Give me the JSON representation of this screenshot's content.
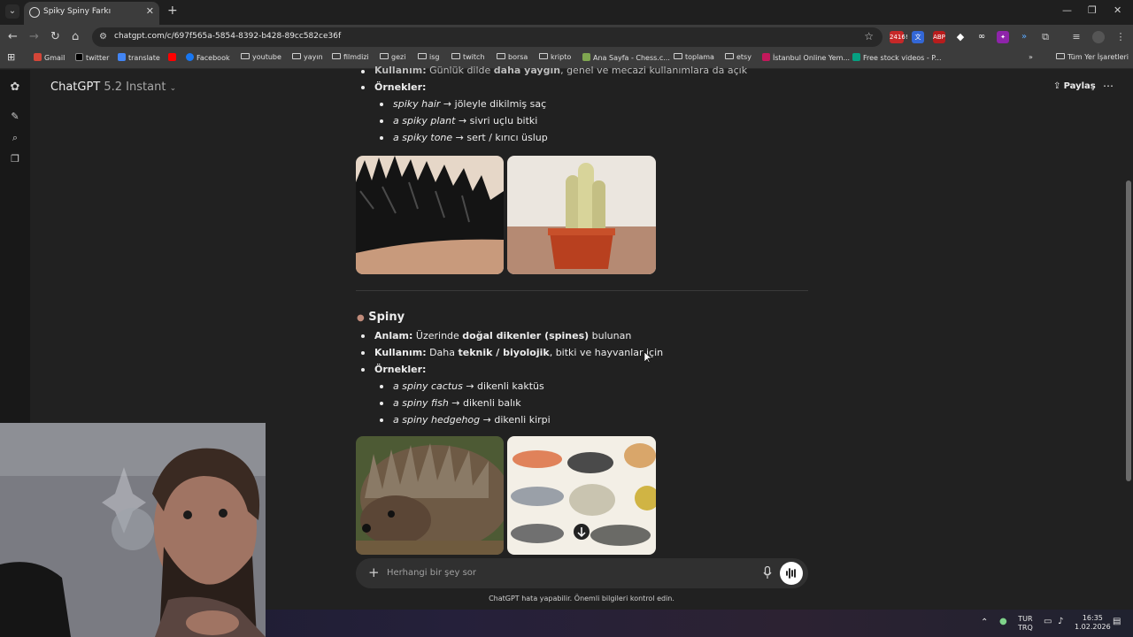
{
  "browser": {
    "tab_title": "Spiky Spiny Farkı",
    "url": "chatgpt.com/c/697f565a-5854-8392-b428-89cc582ce36f",
    "extension_badge": "2416!",
    "bookmarks": [
      {
        "label": "Gmail",
        "color": "#d44638"
      },
      {
        "label": "twitter",
        "color": "#000000"
      },
      {
        "label": "translate",
        "color": "#4285f4"
      },
      {
        "label": "",
        "color": "#ff0000"
      },
      {
        "label": "Facebook",
        "color": "#1877f2"
      },
      {
        "label": "youtube",
        "color": "folder"
      },
      {
        "label": "yayın",
        "color": "folder"
      },
      {
        "label": "filmdizi",
        "color": "folder"
      },
      {
        "label": "gezi",
        "color": "folder"
      },
      {
        "label": "isg",
        "color": "folder"
      },
      {
        "label": "twitch",
        "color": "folder"
      },
      {
        "label": "borsa",
        "color": "folder"
      },
      {
        "label": "kripto",
        "color": "folder"
      },
      {
        "label": "Ana Sayfa - Chess.c...",
        "color": "#7fa650"
      },
      {
        "label": "toplama",
        "color": "folder"
      },
      {
        "label": "etsy",
        "color": "folder"
      },
      {
        "label": "İstanbul Online Yem...",
        "color": "#c2185b"
      },
      {
        "label": "Free stock videos - P...",
        "color": "#05a081"
      }
    ],
    "all_bookmarks": "Tüm Yer İşaretleri"
  },
  "app": {
    "model_name": "ChatGPT",
    "model_version": "5.2 Instant",
    "share_label": "Paylaş"
  },
  "content": {
    "top_partial": {
      "kullanim_label": "Kullanım:",
      "kullanim_pre": " Günlük dilde ",
      "kullanim_bold": "daha yaygın",
      "kullanim_post": ", genel ve mecazi kullanımlara da açık",
      "ornekler_label": "Örnekler:",
      "examples": [
        {
          "term": "spiky hair",
          "meaning": " → jöleyle dikilmiş saç"
        },
        {
          "term": "a spiky plant",
          "meaning": " → sivri uçlu bitki"
        },
        {
          "term": "a spiky tone",
          "meaning": " → sert / kırıcı üslup"
        }
      ]
    },
    "spiny": {
      "heading": "Spiny",
      "anlam_label": "Anlam:",
      "anlam_pre": " Üzerinde ",
      "anlam_bold": "doğal dikenler (spines)",
      "anlam_post": " bulunan",
      "kullanim_label": "Kullanım:",
      "kullanim_pre": " Daha ",
      "kullanim_bold": "teknik / biyolojik",
      "kullanim_post": ", bitki ve hayvanlar için",
      "ornekler_label": "Örnekler:",
      "examples": [
        {
          "term": "a spiny cactus",
          "meaning": " → dikenli kaktüs"
        },
        {
          "term": "a spiny fish",
          "meaning": " → dikenli balık"
        },
        {
          "term": "a spiny hedgehog",
          "meaning": " → dikenli kirpi"
        }
      ]
    }
  },
  "composer": {
    "placeholder": "Herhangi bir şey sor",
    "disclaimer": "ChatGPT hata yapabilir. Önemli bilgileri kontrol edin."
  },
  "taskbar": {
    "lang_top": "TUR",
    "lang_bottom": "TRQ",
    "time": "16:35",
    "date": "1.02.2026"
  }
}
